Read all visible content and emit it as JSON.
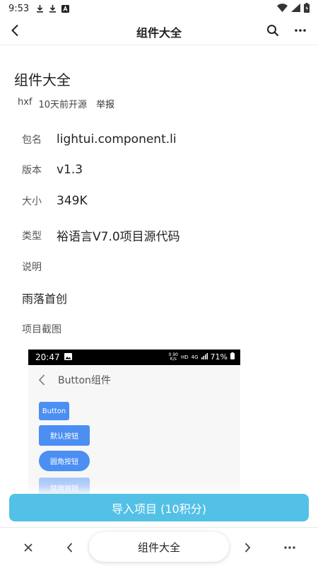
{
  "status_bar": {
    "time": "9:53"
  },
  "app_bar": {
    "title": "组件大全"
  },
  "project": {
    "name": "组件大全",
    "author": "hxf",
    "published": "10天前开源",
    "report": "举报"
  },
  "info": [
    {
      "label": "包名",
      "value": "lightui.component.li"
    },
    {
      "label": "版本",
      "value": "v1.3"
    },
    {
      "label": "大小",
      "value": "349K"
    },
    {
      "label": "类型",
      "value": "裕语言V7.0项目源代码"
    }
  ],
  "description": {
    "label": "说明",
    "value": "雨落首创"
  },
  "screenshots": {
    "label": "项目截图",
    "preview": {
      "time": "20:47",
      "net_speed_top": "0.90",
      "net_speed_bottom": "K/s",
      "hd": "HD",
      "network": "4G",
      "battery": "71%",
      "page_title": "Button组件",
      "buttons": [
        "Button",
        "默认按钮",
        "圆角按钮",
        "禁用按钮"
      ],
      "colors": {
        "primary": "#4b8ff3",
        "disabled": "#a9c8f7"
      }
    }
  },
  "import_button": {
    "label": "导入项目 (10积分)",
    "color": "#53c1e6"
  },
  "bottom_bar": {
    "tab_title": "组件大全"
  }
}
